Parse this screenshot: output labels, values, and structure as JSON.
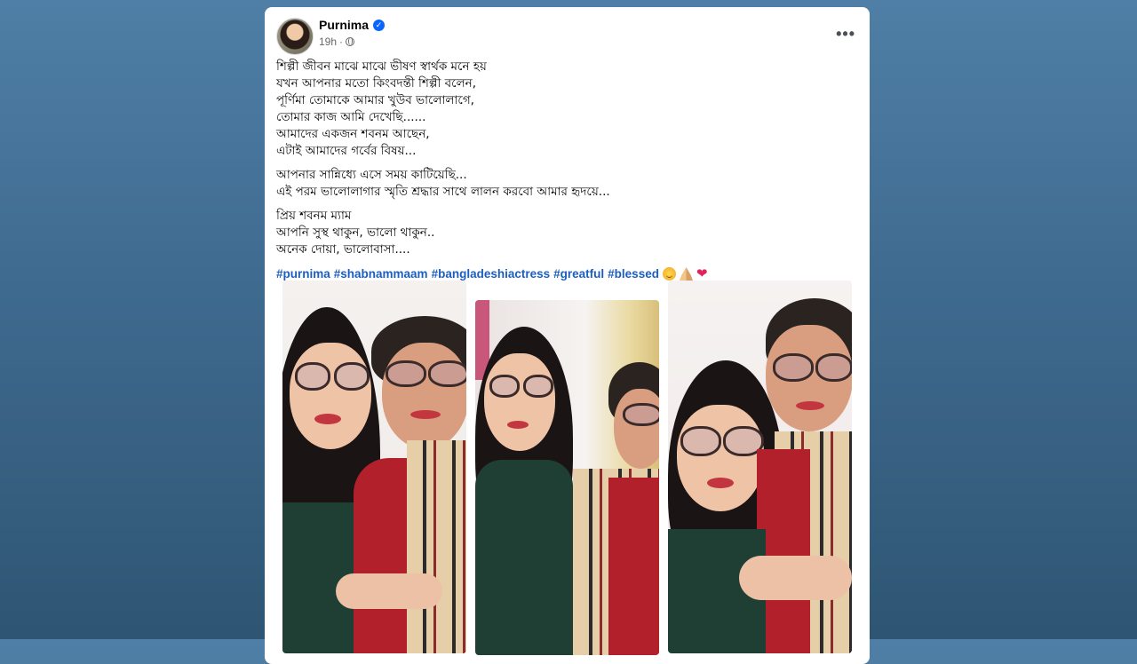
{
  "post": {
    "author": "Purnima",
    "timestamp": "19h",
    "verified_icon": "verified-badge-icon",
    "audience_icon": "globe-icon",
    "more_options": "•••",
    "paragraphs": [
      [
        "শিল্পী জীবন মাঝে মাঝে ভীষণ স্বার্থক মনে হয়",
        "যখন আপনার মতো কিংবদন্তী শিল্পী বলেন,",
        "পূর্ণিমা তোমাকে আমার খুউব ভালোলাগে,",
        "তোমার কাজ আমি দেখেছি......",
        "আমাদের একজন শবনম আছেন,",
        "এটাই আমাদের গর্বের বিষয়..."
      ],
      [
        "আপনার সান্নিধ্যে এসে সময় কাটিয়েছি...",
        "এই পরম ভালোলাগার স্মৃতি শ্রদ্ধার সাথে লালন করবো আমার হৃদয়ে..."
      ],
      [
        "প্রিয় শবনম ম্যাম",
        "আপনি সুস্থ থাকুন, ভালো থাকুন..",
        "অনেক দোয়া, ভালোবাসা...."
      ]
    ],
    "hashtags": [
      "#purnima",
      "#shabnammaam",
      "#bangladeshiactress",
      "#greatful",
      "#blessed"
    ],
    "emojis": [
      "smiling-face-icon",
      "folded-hands-icon",
      "red-heart-icon"
    ],
    "heart_glyph": "❤"
  }
}
